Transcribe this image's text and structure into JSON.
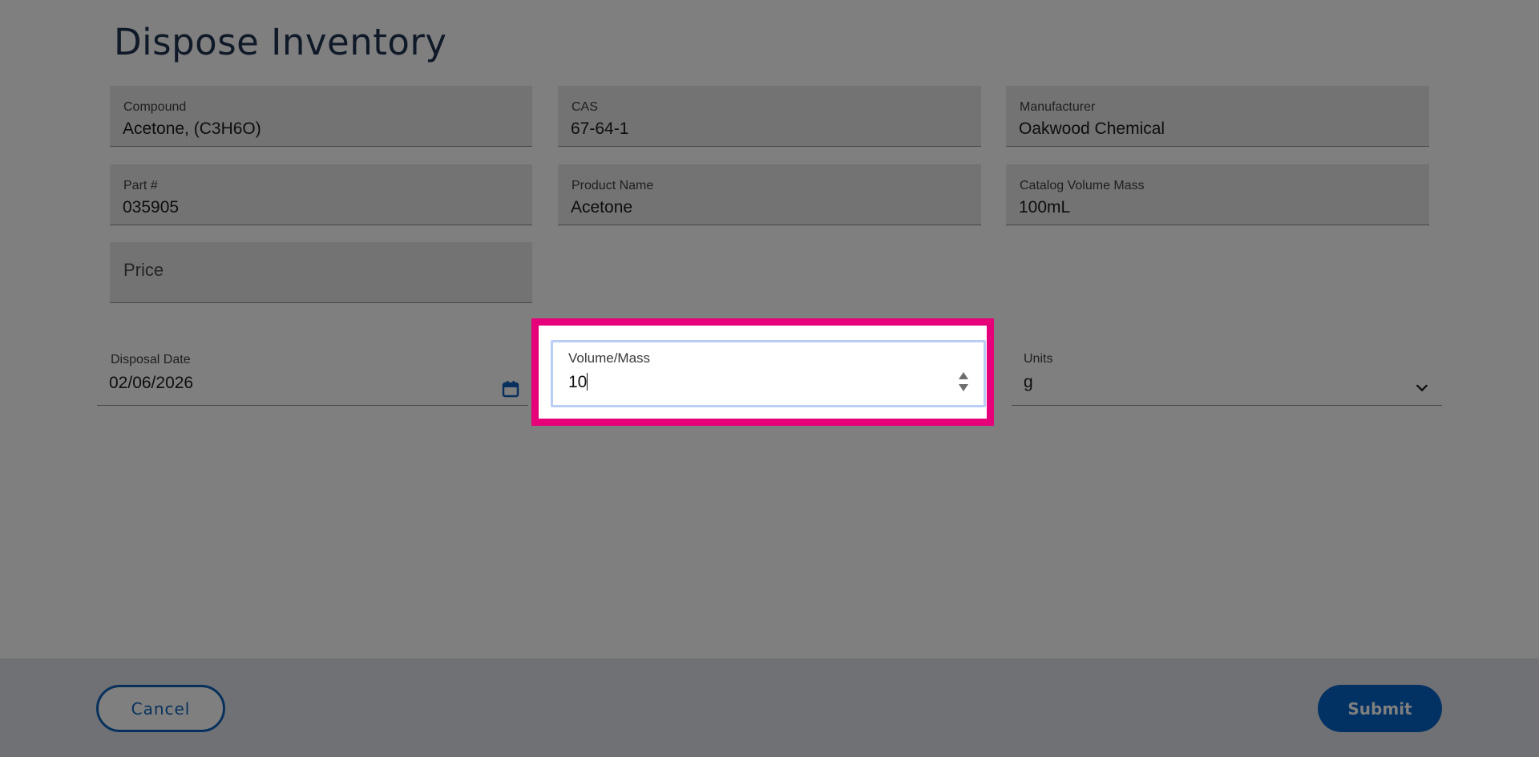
{
  "page": {
    "title": "Dispose Inventory"
  },
  "fields": {
    "compound": {
      "label": "Compound",
      "value": "Acetone, (C3H6O)"
    },
    "cas": {
      "label": "CAS",
      "value": "67-64-1"
    },
    "manufacturer": {
      "label": "Manufacturer",
      "value": "Oakwood Chemical"
    },
    "part_number": {
      "label": "Part #",
      "value": "035905"
    },
    "product_name": {
      "label": "Product Name",
      "value": "Acetone"
    },
    "catalog_volume_mass": {
      "label": "Catalog Volume Mass",
      "value": "100mL"
    },
    "price": {
      "placeholder": "Price"
    },
    "disposal_date": {
      "label": "Disposal Date",
      "value": "02/06/2026",
      "icon": "calendar-icon"
    },
    "volume_mass": {
      "label": "Volume/Mass",
      "value": "10",
      "icon": "spinner-arrows-icon"
    },
    "units": {
      "label": "Units",
      "value": "g",
      "icon": "chevron-down-icon"
    }
  },
  "footer": {
    "cancel_label": "Cancel",
    "submit_label": "Submit"
  },
  "colors": {
    "highlight": "#e6007a",
    "primary": "#0563c8",
    "title": "#1f3350"
  }
}
